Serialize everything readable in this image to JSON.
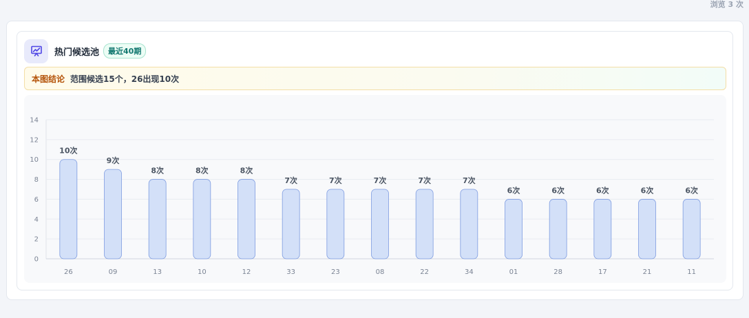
{
  "header": {
    "view_count": "浏览 3 次",
    "title": "热门候选池",
    "badge": "最近40期",
    "icon": "chart-presentation-icon"
  },
  "conclusion": {
    "label": "本图结论",
    "text": "范围候选15个，26出现10次"
  },
  "colors": {
    "bar_fill": "#d3e0f8",
    "bar_stroke": "#7d9be0",
    "accent": "#4f46e5"
  },
  "chart_data": {
    "type": "bar",
    "categories": [
      "26",
      "09",
      "13",
      "10",
      "12",
      "33",
      "23",
      "08",
      "22",
      "34",
      "01",
      "28",
      "17",
      "21",
      "11"
    ],
    "values": [
      10,
      9,
      8,
      8,
      8,
      7,
      7,
      7,
      7,
      7,
      6,
      6,
      6,
      6,
      6
    ],
    "data_labels": [
      "10次",
      "9次",
      "8次",
      "8次",
      "8次",
      "7次",
      "7次",
      "7次",
      "7次",
      "7次",
      "6次",
      "6次",
      "6次",
      "6次",
      "6次"
    ],
    "yticks": [
      0,
      2,
      4,
      6,
      8,
      10,
      12,
      14
    ],
    "ylim": [
      0,
      14
    ],
    "grid": true,
    "title": "",
    "xlabel": "",
    "ylabel": ""
  }
}
